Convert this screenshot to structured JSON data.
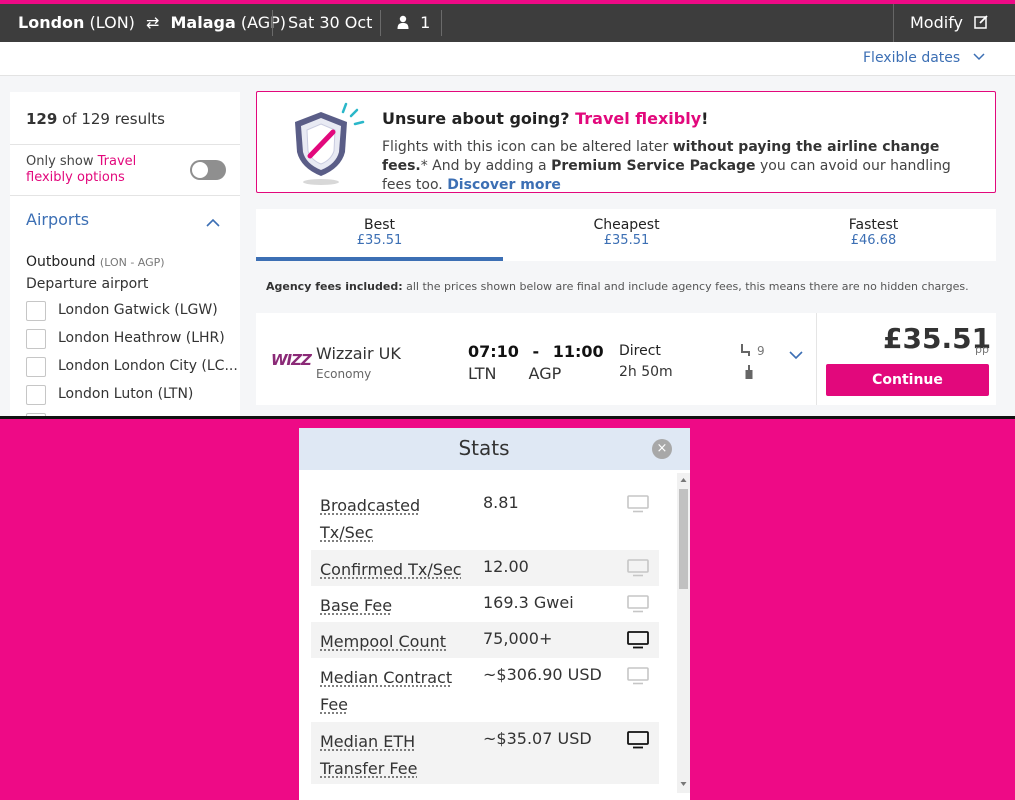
{
  "header": {
    "origin_city": "London",
    "origin_code": "(LON)",
    "dest_city": "Malaga",
    "dest_code": "(AGP)",
    "date": "Sat 30 Oct",
    "passengers": "1",
    "modify_label": "Modify"
  },
  "subbar": {
    "flexible_dates": "Flexible dates"
  },
  "filters": {
    "results_shown": "129",
    "results_of": "of 129 results",
    "only_show_prefix": "Only show ",
    "only_show_link": "Travel flexibly options",
    "toggle_on": false,
    "airports_title": "Airports",
    "outbound_label": "Outbound",
    "outbound_route": "(LON - AGP)",
    "departure_label": "Departure airport",
    "airports": [
      "London Gatwick (LGW)",
      "London Heathrow (LHR)",
      "London London City (LC...",
      "London Luton (LTN)"
    ]
  },
  "banner": {
    "title_prefix": "Unsure about going? ",
    "title_link": "Travel flexibly",
    "title_suffix": "!",
    "body_1": "Flights with this icon can be altered later ",
    "body_bold_1": "without paying the airline change fees.",
    "body_2": "* And by adding a ",
    "body_bold_2": "Premium Service Package",
    "body_3": " you can avoid our handling fees too. ",
    "discover": "Discover more"
  },
  "tabs": [
    {
      "label": "Best",
      "price": "£35.51",
      "active": true
    },
    {
      "label": "Cheapest",
      "price": "£35.51",
      "active": false
    },
    {
      "label": "Fastest",
      "price": "£46.68",
      "active": false
    }
  ],
  "fees_note": {
    "bold": "Agency fees included:",
    "text": " all the prices shown below are final and include agency fees, this means there are no hidden charges."
  },
  "result": {
    "logo_text": "WIZZ",
    "airline": "Wizzair UK",
    "cabin": "Economy",
    "dep_time": "07:10",
    "time_sep": "-",
    "arr_time": "11:00",
    "dep_code": "LTN",
    "arr_code": "AGP",
    "stops": "Direct",
    "duration": "2h 50m",
    "seats": "9",
    "price": "£35.51",
    "price_unit": "pp",
    "continue_label": "Continue"
  },
  "stats": {
    "title": "Stats",
    "close": "×",
    "rows": [
      {
        "key": "Broadcasted Tx/Sec",
        "value": "8.81",
        "monitor_active": false
      },
      {
        "key": "Confirmed Tx/Sec",
        "value": "12.00",
        "monitor_active": false
      },
      {
        "key": "Base Fee",
        "value": "169.3 Gwei",
        "monitor_active": false
      },
      {
        "key": "Mempool Count",
        "value": "75,000+",
        "monitor_active": true
      },
      {
        "key": "Median Contract Fee",
        "value": "~$306.90 USD",
        "monitor_active": false
      },
      {
        "key": "Median ETH Transfer Fee",
        "value": "~$35.07 USD",
        "monitor_active": true
      }
    ]
  },
  "colors": {
    "brand_pink": "#e2087c",
    "link_blue": "#3c6fb4",
    "header_dark": "#3d3d3d",
    "backdrop_pink": "#ee0a86"
  }
}
